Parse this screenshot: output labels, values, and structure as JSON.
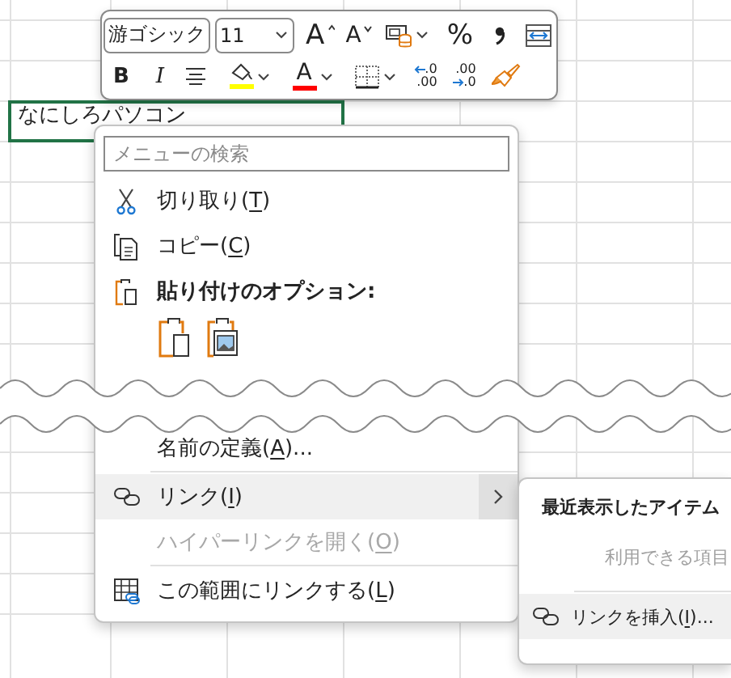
{
  "spreadsheet": {
    "active_cell": {
      "value": "なにしろパソコン"
    }
  },
  "mini_toolbar": {
    "row_1": [
      {
        "kind": "font-name",
        "value": "游ゴシック"
      },
      {
        "kind": "font-size",
        "value": "11"
      },
      {
        "kind": "grow-font",
        "label": "A"
      },
      {
        "kind": "shrink-font",
        "label": "A"
      },
      {
        "kind": "cell-styles"
      },
      {
        "kind": "percent",
        "label": "%"
      },
      {
        "kind": "comma"
      },
      {
        "kind": "merge"
      }
    ],
    "row_2": [
      {
        "kind": "bold",
        "label": "B"
      },
      {
        "kind": "italic",
        "label": "I"
      },
      {
        "kind": "align"
      },
      {
        "kind": "fill-color",
        "color": "#ffff00"
      },
      {
        "kind": "font-color",
        "label": "A",
        "color": "#ff0000"
      },
      {
        "kind": "borders"
      },
      {
        "kind": "add-decimal",
        "upper": ".0",
        "lower": ".00"
      },
      {
        "kind": "remove-decimal",
        "upper": ".00",
        "lower": ".0"
      },
      {
        "kind": "format-painter"
      }
    ]
  },
  "context_menu": {
    "search": {
      "placeholder": "メニューの検索"
    },
    "sections": [
      [
        {
          "kind": "cut",
          "before": "切り取り(",
          "key": "T",
          "after": ")",
          "selected": false,
          "disabled": false,
          "submenu": false
        },
        {
          "kind": "copy",
          "before": "コピー(",
          "key": "C",
          "after": ")",
          "selected": false,
          "disabled": false,
          "submenu": false
        },
        {
          "kind": "paste-heading",
          "label": "貼り付けのオプション:"
        },
        {
          "kind": "paste-buttons"
        }
      ],
      [
        {
          "kind": "define-name",
          "before": "名前の定義(",
          "key": "A",
          "after": ")...",
          "selected": false,
          "disabled": false,
          "submenu": false
        },
        {
          "kind": "separator"
        },
        {
          "kind": "link",
          "before": "リンク(",
          "key": "I",
          "after": ")",
          "selected": true,
          "disabled": false,
          "submenu": true
        },
        {
          "kind": "open-hyperlink",
          "before": "ハイパーリンクを開く(",
          "key": "O",
          "after": ")",
          "selected": false,
          "disabled": true,
          "submenu": false
        },
        {
          "kind": "separator"
        },
        {
          "kind": "range-link",
          "before": "この範囲にリンクする(",
          "key": "L",
          "after": ")",
          "selected": false,
          "disabled": false,
          "submenu": false
        }
      ]
    ]
  },
  "submenu": {
    "title": "最近表示したアイテム",
    "empty_text": "利用できる項目",
    "items": [
      {
        "kind": "insert-link",
        "before": "リンクを挿入(",
        "key": "I",
        "after": ")...",
        "selected": true
      }
    ]
  }
}
